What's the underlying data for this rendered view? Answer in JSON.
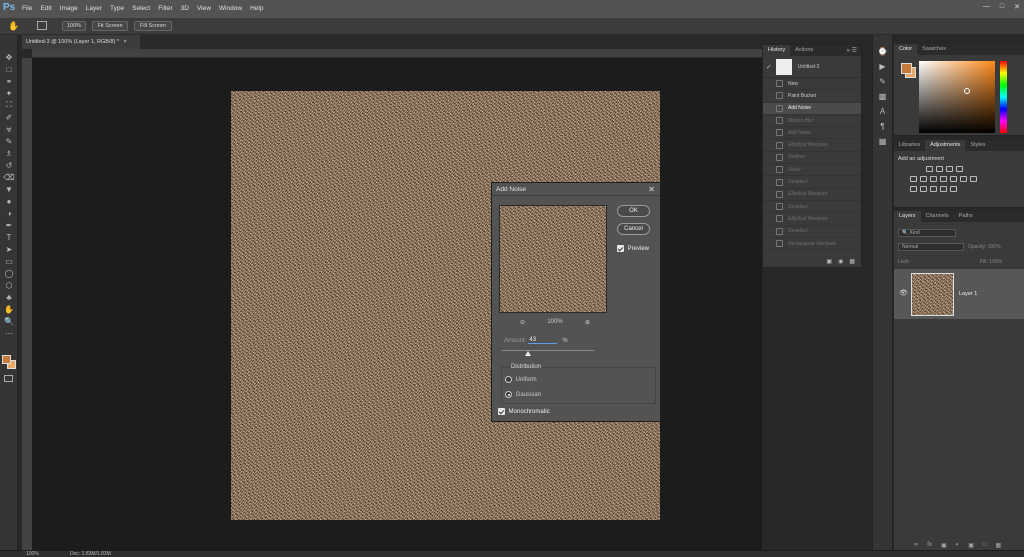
{
  "app": {
    "logo": "Ps"
  },
  "menu": [
    "File",
    "Edit",
    "Image",
    "Layer",
    "Type",
    "Select",
    "Filter",
    "3D",
    "View",
    "Window",
    "Help"
  ],
  "options_bar": {
    "zoom_btn": "100%",
    "fit_screen": "Fit Screen",
    "fill_screen": "Fill Screen"
  },
  "doc_tab": {
    "title": "Untitled-3 @ 100% (Layer 1, RGB/8) *",
    "close": "×"
  },
  "status": {
    "zoom": "100%",
    "doc": "Doc: 1.83M/1.83M"
  },
  "history": {
    "tabs": [
      "History",
      "Actions"
    ],
    "snapshot": "Untitled-3",
    "items": [
      {
        "label": "New",
        "state": "active"
      },
      {
        "label": "Paint Bucket",
        "state": "active"
      },
      {
        "label": "Add Noise",
        "state": "selected"
      },
      {
        "label": "Motion Blur",
        "state": "inactive"
      },
      {
        "label": "Add Noise",
        "state": "inactive"
      },
      {
        "label": "Elliptical Marquee",
        "state": "inactive"
      },
      {
        "label": "Feather",
        "state": "inactive"
      },
      {
        "label": "Wave",
        "state": "inactive"
      },
      {
        "label": "Deselect",
        "state": "inactive"
      },
      {
        "label": "Elliptical Marquee",
        "state": "inactive"
      },
      {
        "label": "Deselect",
        "state": "inactive"
      },
      {
        "label": "Elliptical Marquee",
        "state": "inactive"
      },
      {
        "label": "Deselect",
        "state": "inactive"
      },
      {
        "label": "Rectangular Marquee",
        "state": "inactive"
      }
    ]
  },
  "color_panel": {
    "tabs": [
      "Color",
      "Swatches"
    ],
    "fg": "#c87a3a",
    "bg": "#e8a868"
  },
  "adjustments": {
    "tabs": [
      "Libraries",
      "Adjustments",
      "Styles"
    ],
    "heading": "Add an adjustment"
  },
  "layers": {
    "tabs": [
      "Layers",
      "Channels",
      "Paths"
    ],
    "kind": "Kind",
    "blend": "Normal",
    "opacity_label": "Opacity:",
    "opacity": "100%",
    "lock_label": "Lock:",
    "fill_label": "Fill:",
    "fill": "100%",
    "layer_name": "Layer 1"
  },
  "dialog": {
    "title": "Add Noise",
    "ok": "OK",
    "cancel": "Cancel",
    "preview_label": "Preview",
    "preview_checked": true,
    "zoom": "100%",
    "amount_label": "Amount:",
    "amount": "43",
    "amount_unit": "%",
    "amount_fraction": 0.43,
    "distribution_label": "Distribution",
    "uniform": "Uniform",
    "gaussian": "Gaussian",
    "selected_distribution": "Gaussian",
    "mono_label": "Monochromatic",
    "mono_checked": true
  },
  "toolbar_icons": [
    "move-icon",
    "marquee-icon",
    "lasso-icon",
    "magic-wand-icon",
    "crop-icon",
    "eyedropper-icon",
    "healing-brush-icon",
    "brush-icon",
    "clone-stamp-icon",
    "history-brush-icon",
    "eraser-icon",
    "paint-bucket-icon",
    "blur-icon",
    "dodge-icon",
    "pen-icon",
    "type-icon",
    "path-selection-icon",
    "rectangle-icon",
    "ellipse-icon",
    "polygon-icon",
    "custom-shape-icon",
    "hand-icon",
    "zoom-icon",
    "more-icon"
  ]
}
